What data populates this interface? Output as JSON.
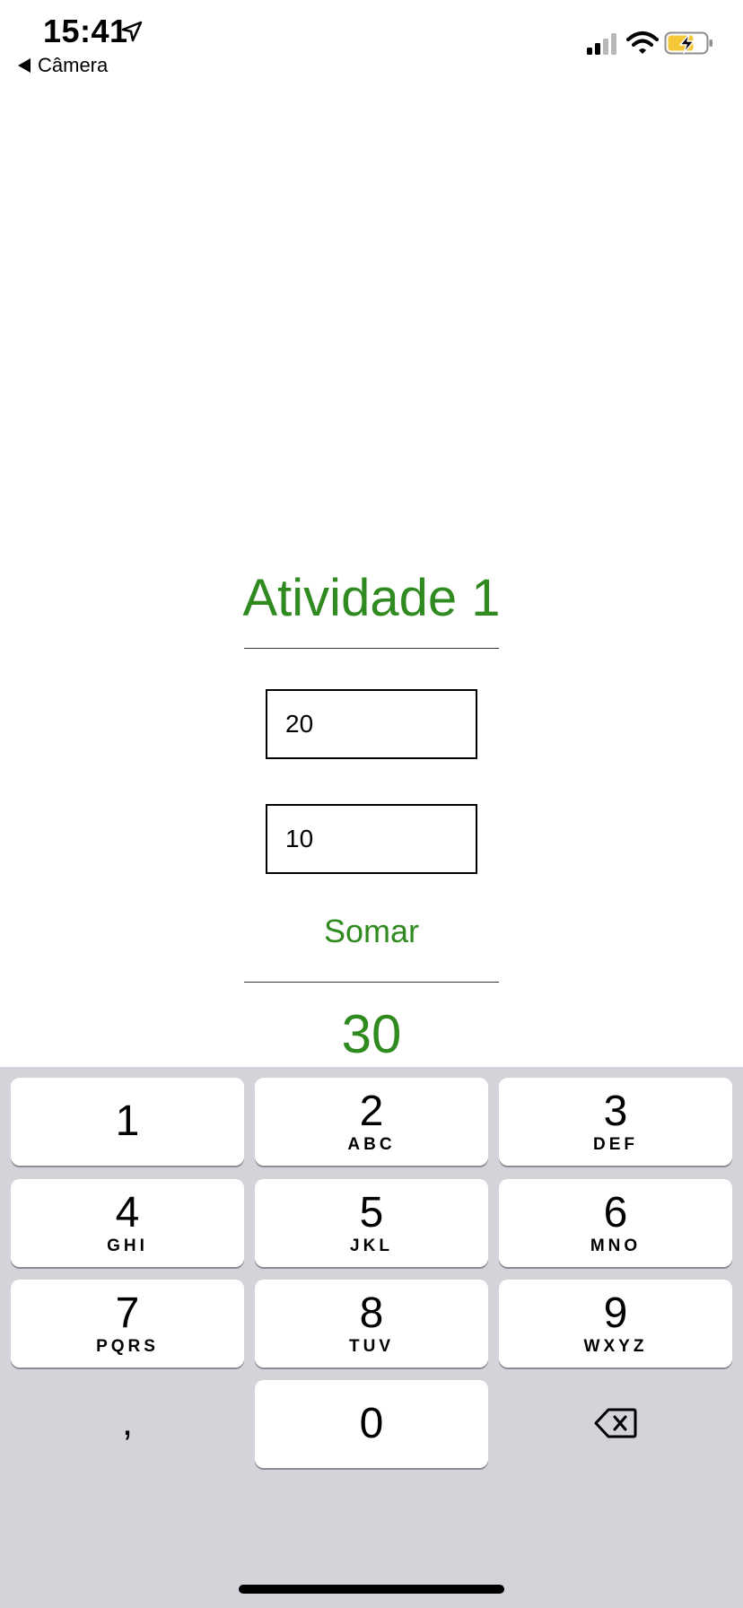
{
  "status_bar": {
    "time": "15:41",
    "back_label": "Câmera"
  },
  "app": {
    "title": "Atividade 1",
    "input_a_value": "20",
    "input_b_value": "10",
    "button_label": "Somar",
    "result": "30"
  },
  "colors": {
    "accent": "#2f8a1f",
    "keyboard_bg": "#d2d4da",
    "battery_fill": "#f5c83a"
  },
  "keyboard": {
    "keys": [
      {
        "digit": "1",
        "letters": ""
      },
      {
        "digit": "2",
        "letters": "ABC"
      },
      {
        "digit": "3",
        "letters": "DEF"
      },
      {
        "digit": "4",
        "letters": "GHI"
      },
      {
        "digit": "5",
        "letters": "JKL"
      },
      {
        "digit": "6",
        "letters": "MNO"
      },
      {
        "digit": "7",
        "letters": "PQRS"
      },
      {
        "digit": "8",
        "letters": "TUV"
      },
      {
        "digit": "9",
        "letters": "WXYZ"
      },
      {
        "digit": "0",
        "letters": ""
      }
    ],
    "comma": ",",
    "backspace_icon": "backspace-icon"
  }
}
